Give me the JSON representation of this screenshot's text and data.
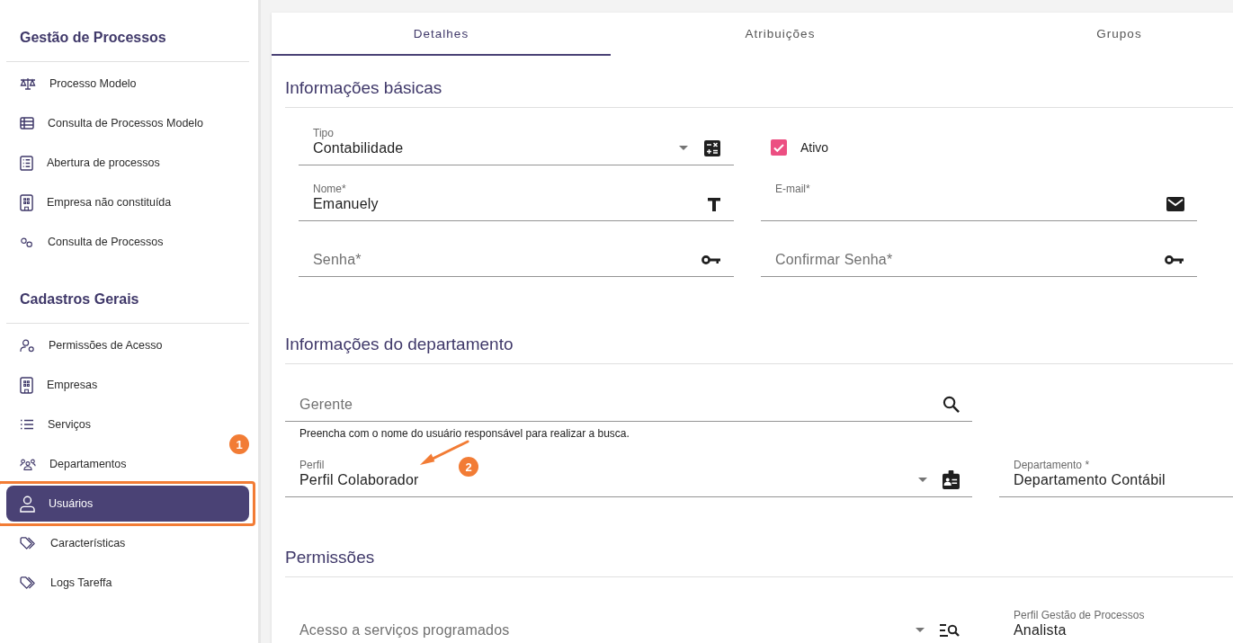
{
  "sidebar": {
    "sections": [
      {
        "title": "Gestão de Processos",
        "items": [
          {
            "label": "Processo Modelo",
            "selected": false,
            "highlighted": false
          },
          {
            "label": "Consulta de Processos Modelo",
            "selected": false,
            "highlighted": false
          },
          {
            "label": "Abertura de processos",
            "selected": false,
            "highlighted": false
          },
          {
            "label": "Empresa não constituída",
            "selected": false,
            "highlighted": false
          },
          {
            "label": "Consulta de Processos",
            "selected": false,
            "highlighted": false
          }
        ]
      },
      {
        "title": "Cadastros Gerais",
        "items": [
          {
            "label": "Permissões de Acesso",
            "selected": false,
            "highlighted": false
          },
          {
            "label": "Empresas",
            "selected": false,
            "highlighted": false
          },
          {
            "label": "Serviços",
            "selected": false,
            "highlighted": false
          },
          {
            "label": "Departamentos",
            "selected": false,
            "highlighted": false
          },
          {
            "label": "Usuários",
            "selected": true,
            "highlighted": true
          },
          {
            "label": "Características",
            "selected": false,
            "highlighted": false
          },
          {
            "label": "Logs Tareffa",
            "selected": false,
            "highlighted": false
          }
        ]
      }
    ]
  },
  "tabs": [
    {
      "label": "Detalhes",
      "selected": true
    },
    {
      "label": "Atribuições",
      "selected": false
    },
    {
      "label": "Grupos",
      "selected": false
    }
  ],
  "sections": [
    {
      "title": "Informações básicas",
      "fields": [
        {
          "kind": "select",
          "label": "Tipo",
          "value": "Contabilidade"
        },
        {
          "kind": "checkbox",
          "label": "Ativo",
          "checked": true
        },
        {
          "kind": "text",
          "label": "Nome*",
          "value": "Emanuely"
        },
        {
          "kind": "text",
          "label": "E-mail*"
        },
        {
          "kind": "text",
          "placeholder": "Senha*"
        },
        {
          "kind": "text",
          "placeholder": "Confirmar Senha*"
        }
      ]
    },
    {
      "title": "Informações do departamento",
      "fields": [
        {
          "kind": "text",
          "placeholder": "Gerente",
          "hint": "Preencha com o nome do usuário responsável para realizar a busca."
        },
        {
          "kind": "select",
          "label": "Perfil",
          "value": "Perfil Colaborador"
        },
        {
          "kind": "text",
          "label": "Departamento *",
          "value": "Departamento Contábil"
        }
      ]
    },
    {
      "title": "Permissões",
      "fields": [
        {
          "kind": "select",
          "placeholder": "Acesso a serviços programados"
        },
        {
          "kind": "text",
          "label": "Perfil Gestão de Processos",
          "value": "Analista"
        }
      ]
    }
  ],
  "annotations": [
    {
      "label": "1"
    },
    {
      "label": "2"
    }
  ]
}
